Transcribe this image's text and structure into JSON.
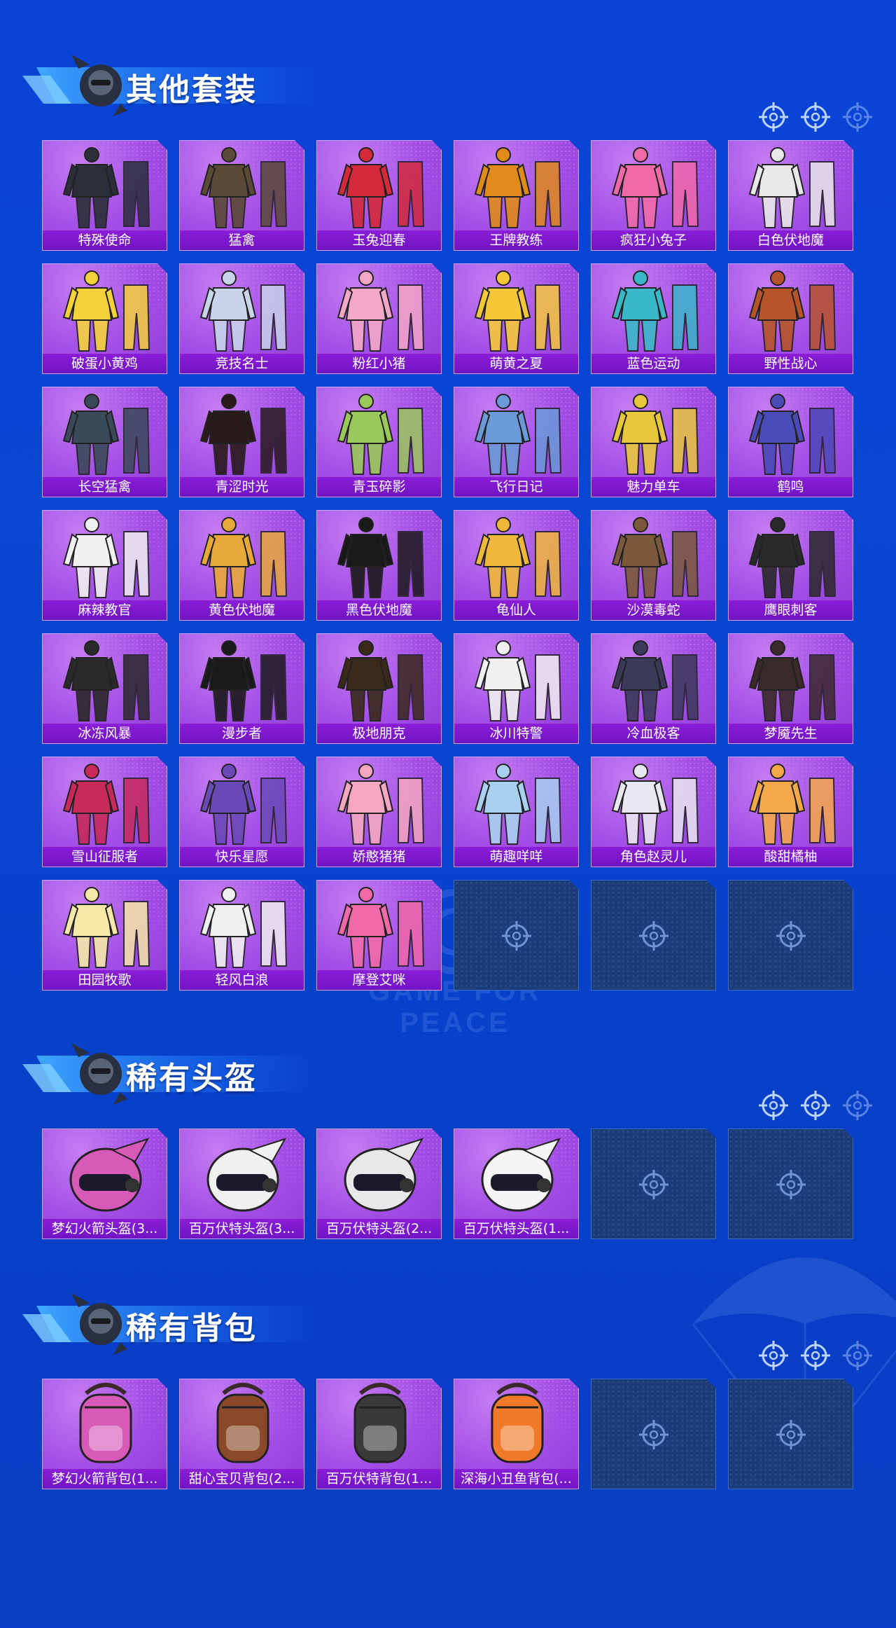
{
  "sections": [
    {
      "title": "其他套装",
      "items": [
        {
          "label": "特殊使命",
          "icon": "outfit-icon",
          "color": "#2a2f3a"
        },
        {
          "label": "猛禽",
          "icon": "outfit-icon",
          "color": "#5a4a36"
        },
        {
          "label": "玉兔迎春",
          "icon": "outfit-icon",
          "color": "#d42a3a"
        },
        {
          "label": "王牌教练",
          "icon": "outfit-icon",
          "color": "#e08a1a"
        },
        {
          "label": "疯狂小兔子",
          "icon": "outfit-icon",
          "color": "#f06aa8"
        },
        {
          "label": "白色伏地魔",
          "icon": "outfit-icon",
          "color": "#e8e8e8"
        },
        {
          "label": "破蛋小黄鸡",
          "icon": "outfit-icon",
          "color": "#f5d23a"
        },
        {
          "label": "竞技名士",
          "icon": "outfit-icon",
          "color": "#c8d4ea"
        },
        {
          "label": "粉红小猪",
          "icon": "outfit-icon",
          "color": "#f5a8c8"
        },
        {
          "label": "萌黄之夏",
          "icon": "outfit-icon",
          "color": "#f5c83a"
        },
        {
          "label": "蓝色运动",
          "icon": "outfit-icon",
          "color": "#3ab8c8"
        },
        {
          "label": "野性战心",
          "icon": "outfit-icon",
          "color": "#b8542a"
        },
        {
          "label": "长空猛禽",
          "icon": "outfit-icon",
          "color": "#3a4a5a"
        },
        {
          "label": "青涩时光",
          "icon": "outfit-icon",
          "color": "#2a1a1a"
        },
        {
          "label": "青玉碎影",
          "icon": "outfit-icon",
          "color": "#9ac85a"
        },
        {
          "label": "飞行日记",
          "icon": "outfit-icon",
          "color": "#6a9ad8"
        },
        {
          "label": "魅力单车",
          "icon": "outfit-icon",
          "color": "#e8c83a"
        },
        {
          "label": "鹤鸣",
          "icon": "outfit-icon",
          "color": "#4a4ab8"
        },
        {
          "label": "麻辣教官",
          "icon": "outfit-icon",
          "color": "#f0f0f0"
        },
        {
          "label": "黄色伏地魔",
          "icon": "outfit-icon",
          "color": "#e8a83a"
        },
        {
          "label": "黑色伏地魔",
          "icon": "outfit-icon",
          "color": "#1a1a1a"
        },
        {
          "label": "龟仙人",
          "icon": "outfit-icon",
          "color": "#f0b83a"
        },
        {
          "label": "沙漠毒蛇",
          "icon": "outfit-icon",
          "color": "#7a5a3a"
        },
        {
          "label": "鹰眼刺客",
          "icon": "outfit-icon",
          "color": "#2a2a2a"
        },
        {
          "label": "冰冻风暴",
          "icon": "outfit-icon",
          "color": "#2a2a2a"
        },
        {
          "label": "漫步者",
          "icon": "outfit-icon",
          "color": "#1a1a1a"
        },
        {
          "label": "极地朋克",
          "icon": "outfit-icon",
          "color": "#3a2a1a"
        },
        {
          "label": "冰川特警",
          "icon": "outfit-icon",
          "color": "#f0f0f0"
        },
        {
          "label": "冷血极客",
          "icon": "outfit-icon",
          "color": "#3a3a5a"
        },
        {
          "label": "梦魇先生",
          "icon": "outfit-icon",
          "color": "#3a2a2a"
        },
        {
          "label": "雪山征服者",
          "icon": "outfit-icon",
          "color": "#c82a5a"
        },
        {
          "label": "快乐星愿",
          "icon": "outfit-icon",
          "color": "#6a4ab8"
        },
        {
          "label": "娇憨猪猪",
          "icon": "outfit-icon",
          "color": "#f5a8c0"
        },
        {
          "label": "萌趣咩咩",
          "icon": "outfit-icon",
          "color": "#a8d0f0"
        },
        {
          "label": "角色赵灵儿",
          "icon": "outfit-icon",
          "color": "#e8e8f0"
        },
        {
          "label": "酸甜橘柚",
          "icon": "outfit-icon",
          "color": "#f5a84a"
        },
        {
          "label": "田园牧歌",
          "icon": "outfit-icon",
          "color": "#f5e8a8"
        },
        {
          "label": "轻风白浪",
          "icon": "outfit-icon",
          "color": "#f0f0f0"
        },
        {
          "label": "摩登艾咪",
          "icon": "outfit-icon",
          "color": "#f06aa8"
        }
      ],
      "empty_slots": 3
    },
    {
      "title": "稀有头盔",
      "items": [
        {
          "label": "梦幻火箭头盔(3...",
          "icon": "helmet-icon",
          "color": "#d85ab8"
        },
        {
          "label": "百万伏特头盔(3...",
          "icon": "helmet-icon",
          "color": "#f0f0f0"
        },
        {
          "label": "百万伏特头盔(2...",
          "icon": "helmet-icon",
          "color": "#e8e8e8"
        },
        {
          "label": "百万伏特头盔(1...",
          "icon": "helmet-icon",
          "color": "#f5f5f5"
        }
      ],
      "empty_slots": 2
    },
    {
      "title": "稀有背包",
      "items": [
        {
          "label": "梦幻火箭背包(1...",
          "icon": "backpack-icon",
          "color": "#d85ab8"
        },
        {
          "label": "甜心宝贝背包(2...",
          "icon": "backpack-icon",
          "color": "#8a4a2a"
        },
        {
          "label": "百万伏特背包(1...",
          "icon": "backpack-icon",
          "color": "#3a3a3a"
        },
        {
          "label": "深海小丑鱼背包(...",
          "icon": "backpack-icon",
          "color": "#f07a2a"
        }
      ],
      "empty_slots": 2
    }
  ],
  "watermark_text": "GAME FOR PEACE",
  "colors": {
    "background": "#0a44d6",
    "card": "#a24de6",
    "label_bar": "#7e18cc",
    "empty_slot": "#1d3d7a"
  }
}
